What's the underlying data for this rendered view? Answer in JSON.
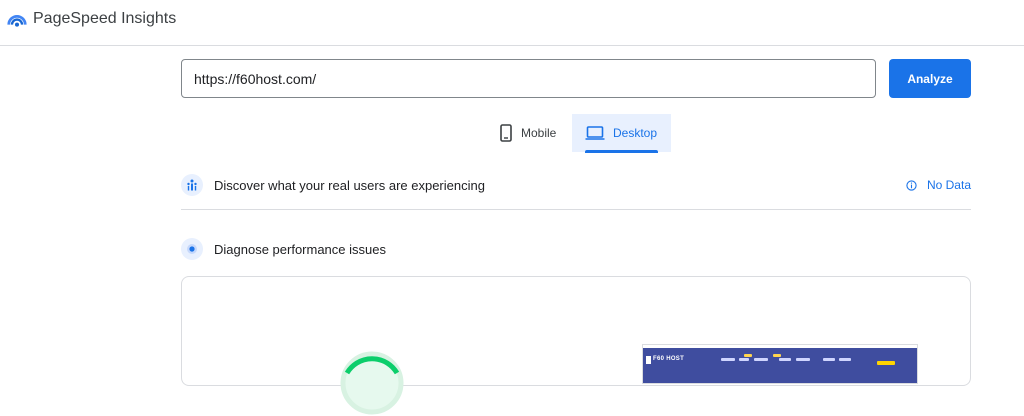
{
  "app": {
    "title": "PageSpeed Insights"
  },
  "form": {
    "url_value": "https://f60host.com/",
    "analyze_label": "Analyze"
  },
  "tabs": [
    {
      "label": "Mobile",
      "selected": false
    },
    {
      "label": "Desktop",
      "selected": true
    }
  ],
  "sections": {
    "field_data": {
      "title": "Discover what your real users are experiencing",
      "status": "No Data"
    },
    "diagnose": {
      "title": "Diagnose performance issues"
    }
  },
  "preview": {
    "brand_text": "F60 HOST"
  },
  "colors": {
    "accent": "#1a73e8",
    "tab_selected_bg": "#e8f0fe",
    "gauge_green": "#0cce6b"
  },
  "icons": {
    "logo": "pagespeed-logo-icon",
    "mobile": "phone-icon",
    "desktop": "laptop-icon",
    "field_data": "people-icon",
    "diagnose": "speed-dot-icon",
    "info": "info-icon"
  }
}
